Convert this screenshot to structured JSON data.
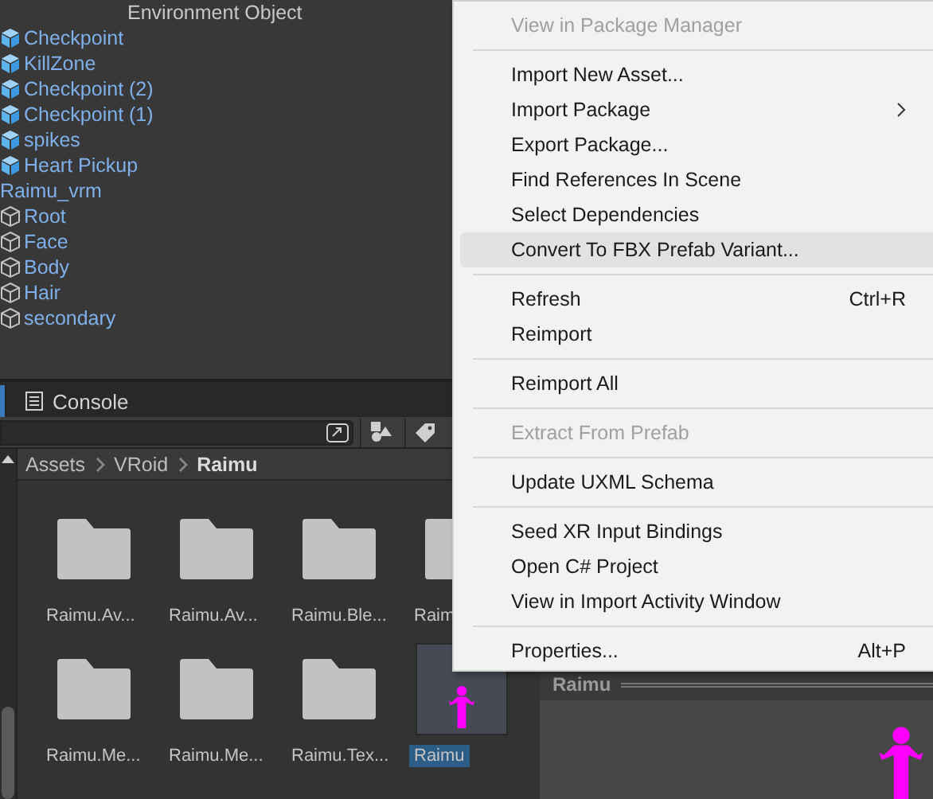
{
  "hierarchy": {
    "items": [
      {
        "label": "Environment Object",
        "kind": "child"
      },
      {
        "label": "Checkpoint",
        "kind": "prefab"
      },
      {
        "label": "KillZone",
        "kind": "prefab"
      },
      {
        "label": "Checkpoint (2)",
        "kind": "prefab"
      },
      {
        "label": "Checkpoint (1)",
        "kind": "prefab"
      },
      {
        "label": "spikes",
        "kind": "prefab"
      },
      {
        "label": "Heart Pickup",
        "kind": "prefab"
      },
      {
        "label": "Raimu_vrm",
        "kind": "root"
      },
      {
        "label": "Root",
        "kind": "object"
      },
      {
        "label": "Face",
        "kind": "object"
      },
      {
        "label": "Body",
        "kind": "object"
      },
      {
        "label": "Hair",
        "kind": "object"
      },
      {
        "label": "secondary",
        "kind": "object"
      }
    ]
  },
  "tabs": [
    {
      "label": "Console",
      "selected": false
    }
  ],
  "breadcrumb": [
    "Assets",
    "VRoid",
    "Raimu"
  ],
  "assets": [
    {
      "label": "Raimu.Av...",
      "kind": "folder",
      "selected": false
    },
    {
      "label": "Raimu.Av...",
      "kind": "folder",
      "selected": false
    },
    {
      "label": "Raimu.Ble...",
      "kind": "folder",
      "selected": false
    },
    {
      "label": "Raim",
      "kind": "folder",
      "selected": false
    },
    {
      "label": "Raimu.Me...",
      "kind": "folder",
      "selected": false
    },
    {
      "label": "Raimu.Me...",
      "kind": "folder",
      "selected": false
    },
    {
      "label": "Raimu.Tex...",
      "kind": "folder",
      "selected": false
    },
    {
      "label": "Raimu",
      "kind": "model",
      "selected": true
    }
  ],
  "preview": {
    "title": "Raimu"
  },
  "context_menu": [
    {
      "kind": "item",
      "label": "View in Package Manager",
      "disabled": true,
      "highlighted": false
    },
    {
      "kind": "separator"
    },
    {
      "kind": "item",
      "label": "Import New Asset...",
      "disabled": false,
      "highlighted": false
    },
    {
      "kind": "item",
      "label": "Import Package",
      "disabled": false,
      "highlighted": false,
      "submenu": true
    },
    {
      "kind": "item",
      "label": "Export Package...",
      "disabled": false,
      "highlighted": false
    },
    {
      "kind": "item",
      "label": "Find References In Scene",
      "disabled": false,
      "highlighted": false
    },
    {
      "kind": "item",
      "label": "Select Dependencies",
      "disabled": false,
      "highlighted": false
    },
    {
      "kind": "item",
      "label": "Convert To FBX Prefab Variant...",
      "disabled": false,
      "highlighted": true
    },
    {
      "kind": "separator"
    },
    {
      "kind": "item",
      "label": "Refresh",
      "shortcut": "Ctrl+R",
      "disabled": false,
      "highlighted": false
    },
    {
      "kind": "item",
      "label": "Reimport",
      "disabled": false,
      "highlighted": false
    },
    {
      "kind": "separator"
    },
    {
      "kind": "item",
      "label": "Reimport All",
      "disabled": false,
      "highlighted": false
    },
    {
      "kind": "separator"
    },
    {
      "kind": "item",
      "label": "Extract From Prefab",
      "disabled": true,
      "highlighted": false
    },
    {
      "kind": "separator"
    },
    {
      "kind": "item",
      "label": "Update UXML Schema",
      "disabled": false,
      "highlighted": false
    },
    {
      "kind": "separator"
    },
    {
      "kind": "item",
      "label": "Seed XR Input Bindings",
      "disabled": false,
      "highlighted": false
    },
    {
      "kind": "item",
      "label": "Open C# Project",
      "disabled": false,
      "highlighted": false
    },
    {
      "kind": "item",
      "label": "View in Import Activity Window",
      "disabled": false,
      "highlighted": false
    },
    {
      "kind": "separator"
    },
    {
      "kind": "item",
      "label": "Properties...",
      "shortcut": "Alt+P",
      "disabled": false,
      "highlighted": false
    }
  ]
}
